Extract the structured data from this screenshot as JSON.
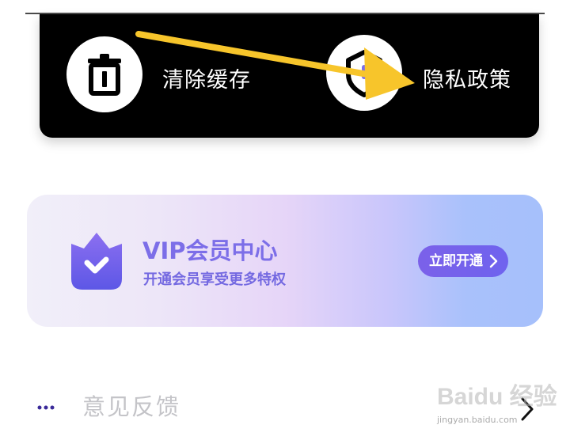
{
  "tools": {
    "clear_cache_label": "清除缓存",
    "privacy_policy_label": "隐私政策",
    "clear_cache_icon": "trash-icon",
    "privacy_policy_icon": "shield-icon"
  },
  "vip": {
    "title": "VIP会员中心",
    "subtitle": "开通会员享受更多特权",
    "button_label": "立即开通",
    "icon": "shield-check-icon",
    "accent_color": "#7b61e9"
  },
  "feedback": {
    "label": "意见反馈",
    "icon": "more-icon"
  },
  "watermark": {
    "mark": "Baidu 经验",
    "url": "jingyan.baidu.com"
  },
  "annotation": {
    "arrow_color": "#f7c52b"
  }
}
